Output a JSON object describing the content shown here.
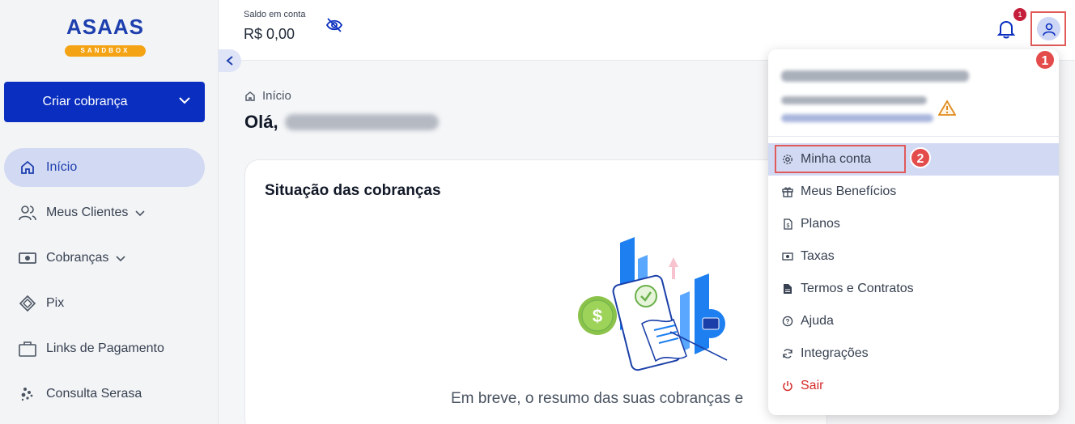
{
  "brand": {
    "logo_text": "ASAAS",
    "badge": "SANDBOX",
    "accent": "#0a2fc0",
    "badge_color": "#f4a315"
  },
  "sidebar": {
    "create_label": "Criar cobrança",
    "items": [
      {
        "label": "Início",
        "icon": "home-icon"
      },
      {
        "label": "Meus Clientes",
        "icon": "users-icon"
      },
      {
        "label": "Cobranças",
        "icon": "money-icon"
      },
      {
        "label": "Pix",
        "icon": "pix-icon"
      },
      {
        "label": "Links de Pagamento",
        "icon": "briefcase-icon"
      },
      {
        "label": "Consulta Serasa",
        "icon": "dots-icon"
      }
    ]
  },
  "header": {
    "balance_label": "Saldo em conta",
    "balance_value": "R$ 0,00",
    "notification_count": "1"
  },
  "main": {
    "breadcrumb": "Início",
    "greeting": "Olá,",
    "card_title": "Situação das cobranças",
    "card_message": "Em breve, o resumo das suas cobranças e"
  },
  "menu": {
    "items": [
      {
        "label": "Minha conta",
        "icon": "gear-icon"
      },
      {
        "label": "Meus Benefícios",
        "icon": "gift-icon"
      },
      {
        "label": "Planos",
        "icon": "plans-icon"
      },
      {
        "label": "Taxas",
        "icon": "cash-icon"
      },
      {
        "label": "Termos e Contratos",
        "icon": "document-icon"
      },
      {
        "label": "Ajuda",
        "icon": "help-icon"
      },
      {
        "label": "Integrações",
        "icon": "sync-icon"
      },
      {
        "label": "Sair",
        "icon": "power-icon"
      }
    ]
  },
  "annotations": {
    "step1": "1",
    "step2": "2",
    "color": "#e44b4b"
  }
}
